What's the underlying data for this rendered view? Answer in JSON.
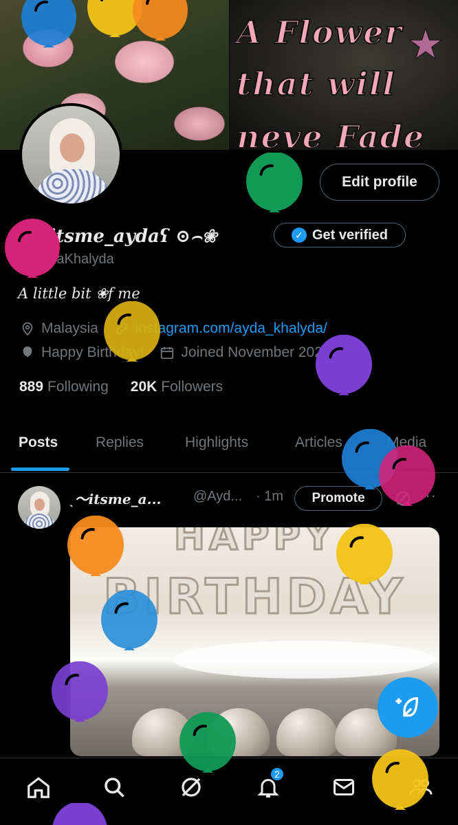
{
  "banner": {
    "text_lines": [
      "A Flower",
      "that will",
      "neve Fade"
    ]
  },
  "profile": {
    "edit_label": "Edit profile",
    "display_name": "ˎˏ〜itsme_aydaʕ ⊙⌢❀",
    "verify_label": "Get verified",
    "handle": "@AydaKhalyda",
    "bio": "A little bit ❀f me",
    "location": "Malaysia",
    "website": "instagram.com/ayda_khalyda/",
    "birthday": "Happy Birthday!",
    "joined": "Joined November 2020",
    "following_count": "889",
    "following_label": "Following",
    "followers_count": "20K",
    "followers_label": "Followers"
  },
  "tabs": [
    {
      "label": "Posts"
    },
    {
      "label": "Replies"
    },
    {
      "label": "Highlights"
    },
    {
      "label": "Articles"
    },
    {
      "label": "Media"
    }
  ],
  "post": {
    "name": "ˎ〜itsme_a...",
    "handle": "@Ayd...",
    "time": "· 1m",
    "promote_label": "Promote",
    "more": "···",
    "media_text_1": "HAPPY",
    "media_text_2": "BIRTHDAY"
  },
  "nav": {
    "notification_count": "2",
    "items": [
      "home-icon",
      "search-icon",
      "grok-icon",
      "bell-icon",
      "mail-icon",
      "communities-icon"
    ]
  },
  "colors": {
    "accent": "#1d9bf0",
    "background": "#000000",
    "secondary_text": "#71767b",
    "balloons": [
      "#1d7fd4",
      "#f3c316",
      "#f58a1e",
      "#d6237a",
      "#109a55",
      "#7a3fd0"
    ]
  }
}
